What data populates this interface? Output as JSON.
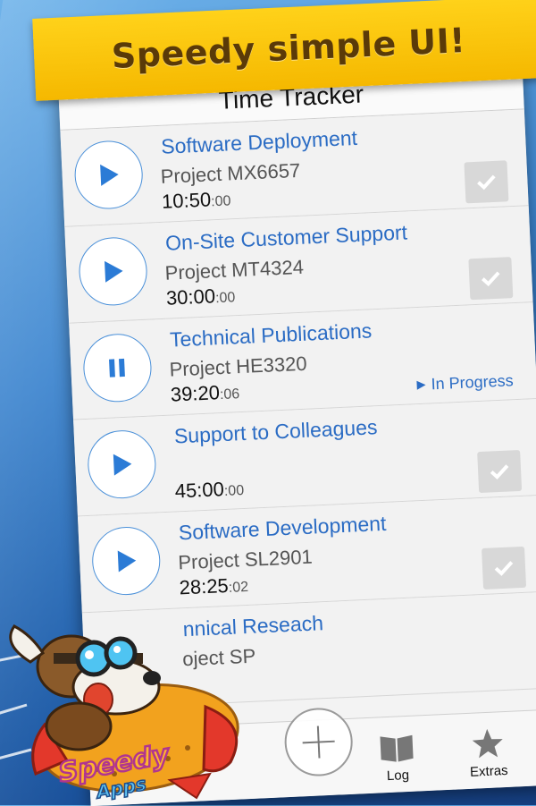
{
  "banner": {
    "text": "Speedy simple UI!"
  },
  "navbar": {
    "title": "Time Tracker"
  },
  "tasks": [
    {
      "title": "Software Deployment",
      "project": "Project MX6657",
      "time": "10:50",
      "seconds": ":00",
      "state": "stopped",
      "checkbox": true
    },
    {
      "title": "On-Site Customer Support",
      "project": "Project MT4324",
      "time": "30:00",
      "seconds": ":00",
      "state": "stopped",
      "checkbox": true
    },
    {
      "title": "Technical Publications",
      "project": "Project HE3320",
      "time": "39:20",
      "seconds": ":06",
      "state": "running",
      "status": "In Progress"
    },
    {
      "title": "Support to Colleagues",
      "project": "",
      "time": "45:00",
      "seconds": ":00",
      "state": "stopped",
      "checkbox": true
    },
    {
      "title": "Software Development",
      "project": "Project SL2901",
      "time": "28:25",
      "seconds": ":02",
      "state": "stopped",
      "checkbox": true
    },
    {
      "title": "nnical Reseach",
      "project": "oject SP",
      "time": "",
      "seconds": "",
      "state": "stopped",
      "checkbox": false
    }
  ],
  "tabbar": {
    "log_label": "Log",
    "extras_label": "Extras"
  },
  "logo": {
    "line1": "Speedy",
    "line2": "Apps"
  },
  "colors": {
    "accent": "#2b6cc4",
    "banner": "#ffcc00",
    "bannerText": "#5a3a08"
  }
}
